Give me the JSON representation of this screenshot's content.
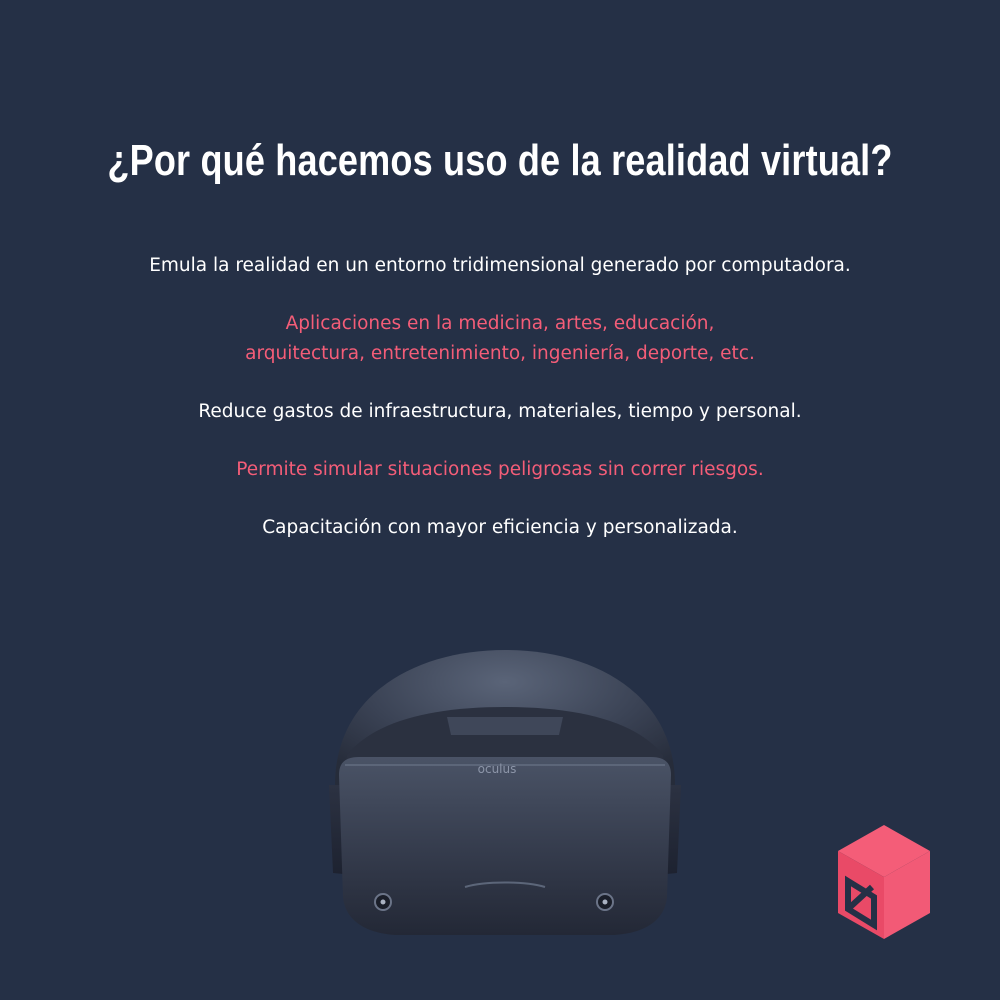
{
  "title": "¿Por qué hacemos uso de la realidad virtual?",
  "points": [
    {
      "lines": [
        "Emula la realidad en un entorno tridimensional generado por computadora."
      ],
      "color": "#ffffff"
    },
    {
      "lines": [
        "Aplicaciones en la medicina, artes, educación,",
        "arquitectura, entretenimiento, ingeniería, deporte, etc."
      ],
      "color": "#f45d78"
    },
    {
      "lines": [
        "Reduce gastos de infraestructura, materiales, tiempo y personal."
      ],
      "color": "#ffffff"
    },
    {
      "lines": [
        "Permite simular situaciones peligrosas sin correr riesgos."
      ],
      "color": "#f45d78"
    },
    {
      "lines": [
        "Capacitación con mayor eficiencia y personalizada."
      ],
      "color": "#ffffff"
    }
  ],
  "headset": {
    "brand": "oculus"
  },
  "colors": {
    "background": "#253046",
    "accent": "#f45d78",
    "text": "#ffffff"
  },
  "icons": {
    "logo": "cube-logo-icon",
    "product": "vr-headset-image"
  }
}
